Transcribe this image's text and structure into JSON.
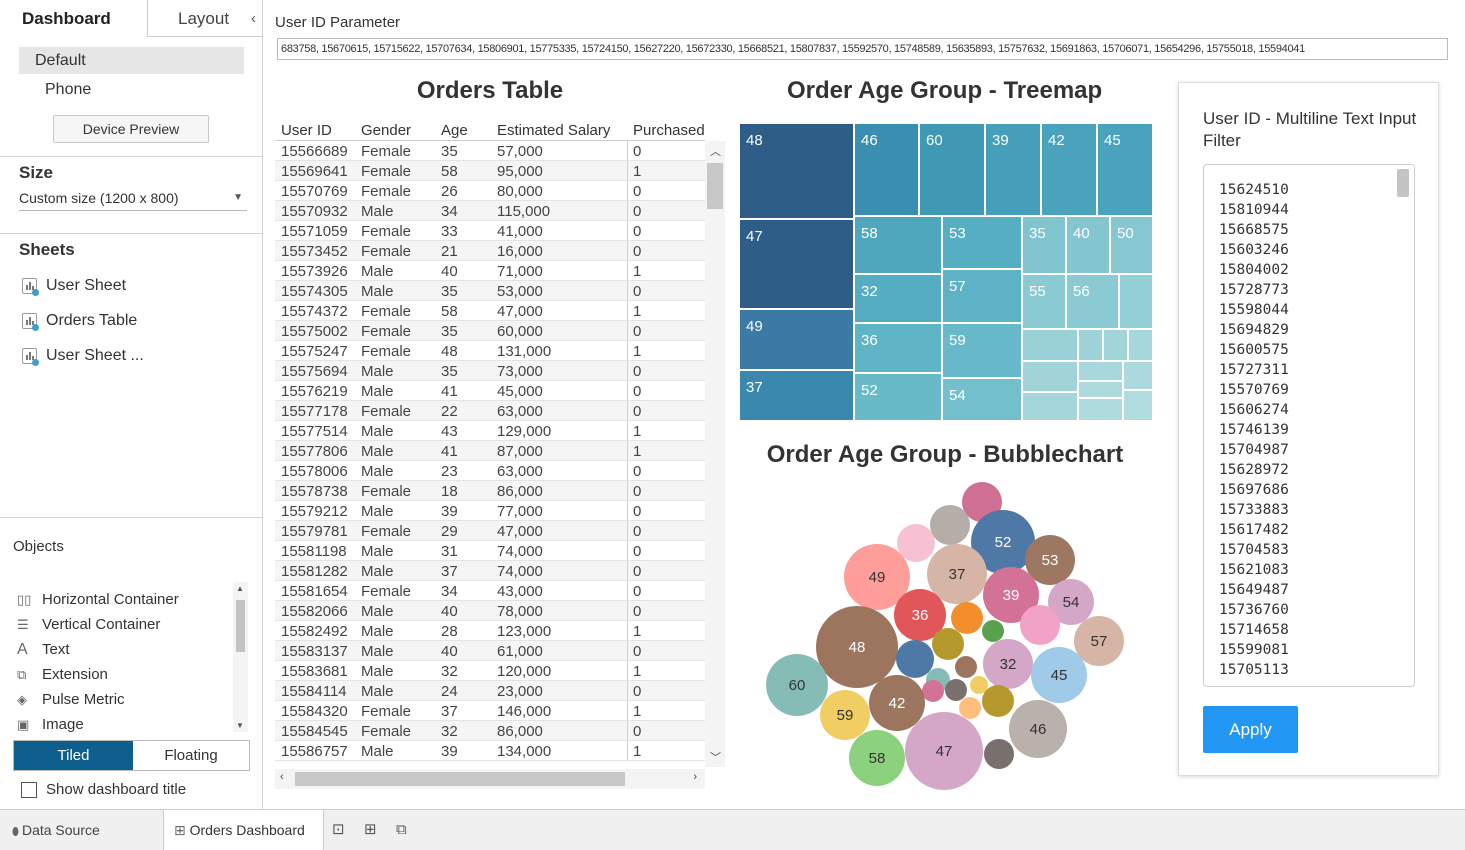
{
  "left_panel": {
    "tabs": [
      "Dashboard",
      "Layout"
    ],
    "devices": [
      "Default",
      "Phone"
    ],
    "device_preview": "Device Preview",
    "size_header": "Size",
    "size_value": "Custom size (1200 x 800)",
    "sheets_header": "Sheets",
    "sheets": [
      "User Sheet",
      "Orders Table",
      "User Sheet ..."
    ],
    "objects_header": "Objects",
    "objects": [
      {
        "icon": "horizontal-container-icon",
        "label": "Horizontal Container"
      },
      {
        "icon": "vertical-container-icon",
        "label": "Vertical Container"
      },
      {
        "icon": "text-icon",
        "label": "Text"
      },
      {
        "icon": "extension-icon",
        "label": "Extension"
      },
      {
        "icon": "pulse-metric-icon",
        "label": "Pulse Metric"
      },
      {
        "icon": "image-icon",
        "label": "Image"
      }
    ],
    "tiled": "Tiled",
    "floating": "Floating",
    "show_title": "Show dashboard title"
  },
  "bottom_tabs": {
    "data_source": "Data Source",
    "orders_dashboard": "Orders Dashboard"
  },
  "parameter": {
    "label": "User ID Parameter",
    "value": "683758, 15670615, 15715622, 15707634, 15806901, 15775335, 15724150, 15627220, 15672330, 15668521, 15807837, 15592570, 15748589, 15635893, 15757632, 15691863, 15706071, 15654296, 15755018, 15594041"
  },
  "orders_table": {
    "title": "Orders Table",
    "columns": [
      "User ID",
      "Gender",
      "Age",
      "Estimated Salary",
      "Purchased"
    ],
    "rows": [
      [
        "15566689",
        "Female",
        "35",
        "57,000",
        "0"
      ],
      [
        "15569641",
        "Female",
        "58",
        "95,000",
        "1"
      ],
      [
        "15570769",
        "Female",
        "26",
        "80,000",
        "0"
      ],
      [
        "15570932",
        "Male",
        "34",
        "115,000",
        "0"
      ],
      [
        "15571059",
        "Female",
        "33",
        "41,000",
        "0"
      ],
      [
        "15573452",
        "Female",
        "21",
        "16,000",
        "0"
      ],
      [
        "15573926",
        "Male",
        "40",
        "71,000",
        "1"
      ],
      [
        "15574305",
        "Male",
        "35",
        "53,000",
        "0"
      ],
      [
        "15574372",
        "Female",
        "58",
        "47,000",
        "1"
      ],
      [
        "15575002",
        "Female",
        "35",
        "60,000",
        "0"
      ],
      [
        "15575247",
        "Female",
        "48",
        "131,000",
        "1"
      ],
      [
        "15575694",
        "Male",
        "35",
        "73,000",
        "0"
      ],
      [
        "15576219",
        "Male",
        "41",
        "45,000",
        "0"
      ],
      [
        "15577178",
        "Female",
        "22",
        "63,000",
        "0"
      ],
      [
        "15577514",
        "Male",
        "43",
        "129,000",
        "1"
      ],
      [
        "15577806",
        "Male",
        "41",
        "87,000",
        "1"
      ],
      [
        "15578006",
        "Male",
        "23",
        "63,000",
        "0"
      ],
      [
        "15578738",
        "Female",
        "18",
        "86,000",
        "0"
      ],
      [
        "15579212",
        "Male",
        "39",
        "77,000",
        "0"
      ],
      [
        "15579781",
        "Female",
        "29",
        "47,000",
        "0"
      ],
      [
        "15581198",
        "Male",
        "31",
        "74,000",
        "0"
      ],
      [
        "15581282",
        "Male",
        "37",
        "74,000",
        "0"
      ],
      [
        "15581654",
        "Female",
        "34",
        "43,000",
        "0"
      ],
      [
        "15582066",
        "Male",
        "40",
        "78,000",
        "0"
      ],
      [
        "15582492",
        "Male",
        "28",
        "123,000",
        "1"
      ],
      [
        "15583137",
        "Male",
        "40",
        "61,000",
        "0"
      ],
      [
        "15583681",
        "Male",
        "32",
        "120,000",
        "1"
      ],
      [
        "15584114",
        "Male",
        "24",
        "23,000",
        "0"
      ],
      [
        "15584320",
        "Female",
        "37",
        "146,000",
        "1"
      ],
      [
        "15584545",
        "Female",
        "32",
        "86,000",
        "0"
      ],
      [
        "15586757",
        "Male",
        "39",
        "134,000",
        "1"
      ]
    ]
  },
  "treemap": {
    "title": "Order Age Group - Treemap",
    "labels": [
      "48",
      "46",
      "60",
      "39",
      "42",
      "45",
      "47",
      "58",
      "53",
      "35",
      "40",
      "50",
      "32",
      "57",
      "55",
      "56",
      "49",
      "36",
      "59",
      "37",
      "52",
      "54"
    ]
  },
  "bubblechart": {
    "title": "Order Age Group - Bubblechart",
    "labels": [
      "52",
      "53",
      "49",
      "37",
      "39",
      "54",
      "36",
      "48",
      "57",
      "32",
      "45",
      "60",
      "42",
      "59",
      "46",
      "47",
      "58"
    ]
  },
  "filter": {
    "title": "User ID - Multiline Text Input Filter",
    "values": "15624510\n15810944\n15668575\n15603246\n15804002\n15728773\n15598044\n15694829\n15600575\n15727311\n15570769\n15606274\n15746139\n15704987\n15628972\n15697686\n15733883\n15617482\n15704583\n15621083\n15649487\n15736760\n15714658\n15599081\n15705113",
    "apply": "Apply"
  }
}
